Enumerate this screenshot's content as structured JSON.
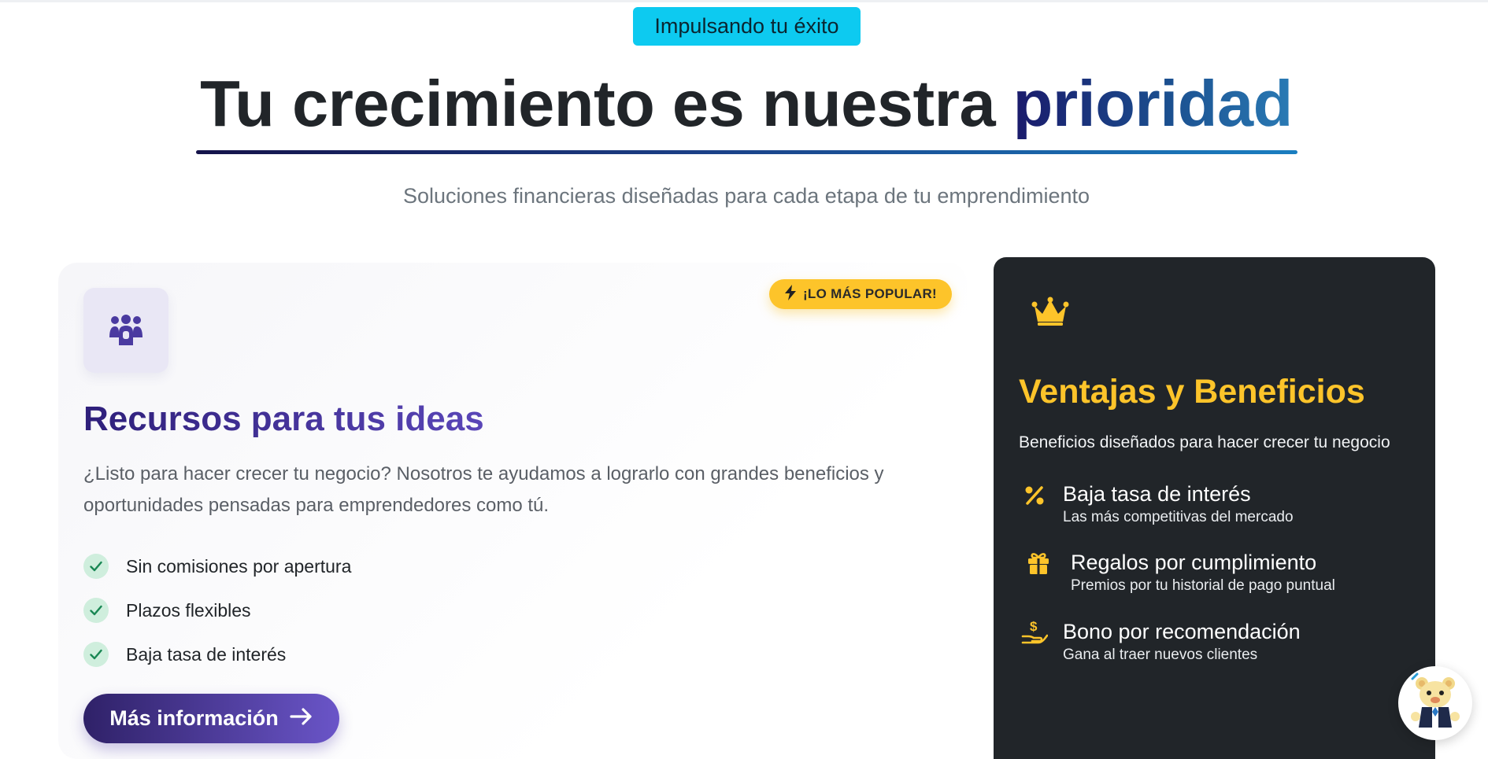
{
  "hero": {
    "badge": "Impulsando tu éxito",
    "title_main": "Tu crecimiento es nuestra ",
    "title_accent": "prioridad",
    "subtitle": "Soluciones financieras diseñadas para cada etapa de tu emprendimiento"
  },
  "left_card": {
    "icon": "users-group-icon",
    "popular_badge": "¡LO MÁS POPULAR!",
    "popular_icon": "bolt-icon",
    "title": "Recursos para tus ideas",
    "description": "¿Listo para hacer crecer tu negocio? Nosotros te ayudamos a lograrlo con grandes beneficios y oportunidades pensadas para emprendedores como tú.",
    "features": [
      {
        "label": "Sin comisiones por apertura",
        "icon": "check-icon"
      },
      {
        "label": "Plazos flexibles",
        "icon": "check-icon"
      },
      {
        "label": "Baja tasa de interés",
        "icon": "check-icon"
      }
    ],
    "button_label": "Más información",
    "button_icon": "arrow-right-icon"
  },
  "right_card": {
    "icon": "crown-icon",
    "title": "Ventajas y Beneficios",
    "subtitle": "Beneficios diseñados para hacer crecer tu negocio",
    "benefits": [
      {
        "title": "Baja tasa de interés",
        "description": "Las más competitivas del mercado",
        "icon": "percent-icon"
      },
      {
        "title": "Regalos por cumplimiento",
        "description": "Premios por tu historial de pago puntual",
        "icon": "gift-icon"
      },
      {
        "title": "Bono por recomendación",
        "description": "Gana al traer nuevos clientes",
        "icon": "hand-coin-icon"
      }
    ]
  },
  "chat_widget": {
    "icon": "mascot-bear-icon"
  },
  "colors": {
    "badge_bg": "#0dcaf0",
    "accent_gold": "#fdc42a",
    "dark_card": "#212529",
    "purple": "#5a46b8",
    "check_green": "#198754"
  }
}
